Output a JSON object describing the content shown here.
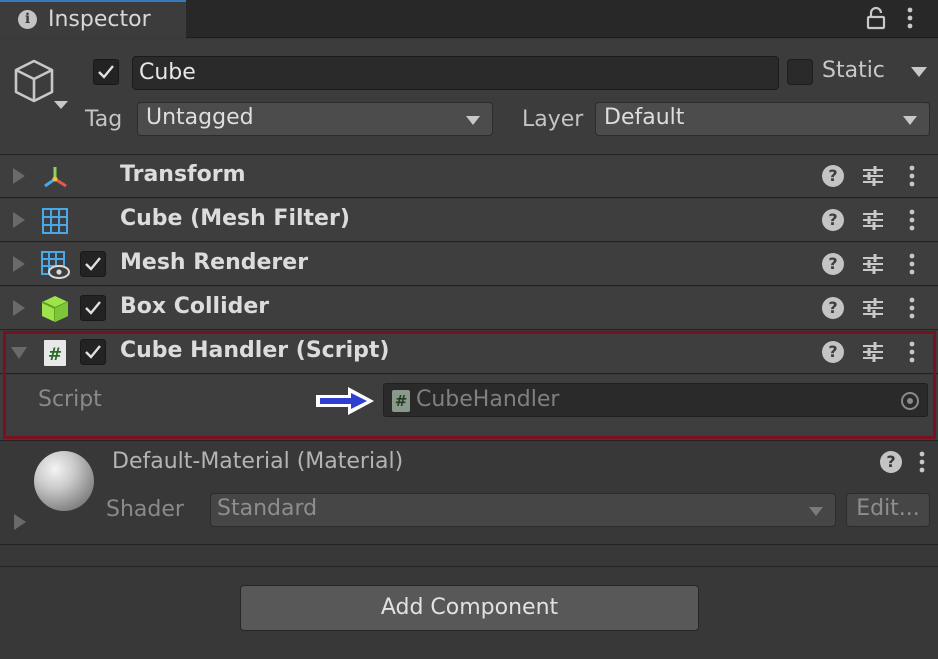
{
  "tab": {
    "label": "Inspector"
  },
  "header": {
    "object_name": "Cube",
    "active": true,
    "static_label": "Static",
    "static_checked": false,
    "tag_label": "Tag",
    "tag_value": "Untagged",
    "layer_label": "Layer",
    "layer_value": "Default"
  },
  "components": [
    {
      "title": "Transform",
      "icon": "transform-icon",
      "has_toggle": false
    },
    {
      "title": "Cube (Mesh Filter)",
      "icon": "mesh-filter-icon",
      "has_toggle": false
    },
    {
      "title": "Mesh Renderer",
      "icon": "mesh-renderer-icon",
      "has_toggle": true,
      "enabled": true
    },
    {
      "title": "Box Collider",
      "icon": "box-collider-icon",
      "has_toggle": true,
      "enabled": true
    },
    {
      "title": "Cube Handler (Script)",
      "icon": "script-icon",
      "has_toggle": true,
      "enabled": true,
      "expanded": true
    }
  ],
  "script_field": {
    "label": "Script",
    "value": "CubeHandler",
    "icon_glyph": "#"
  },
  "material": {
    "title": "Default-Material (Material)",
    "shader_label": "Shader",
    "shader_value": "Standard",
    "edit_label": "Edit..."
  },
  "add_component_label": "Add Component",
  "colors": {
    "highlight_border": "#7a1020",
    "annotation_arrow": "#2f3fd0",
    "tab_accent": "#3a79bb"
  }
}
